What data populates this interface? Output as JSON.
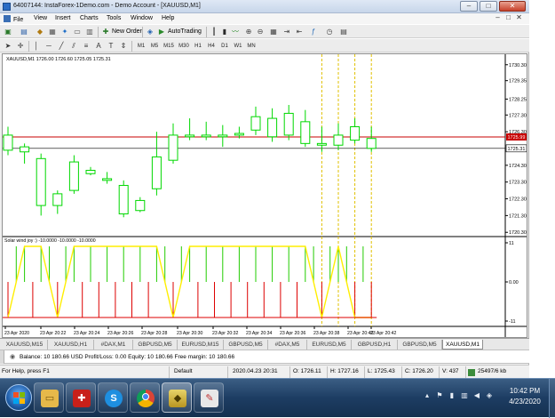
{
  "window": {
    "title": "64007144: InstaForex-1Demo.com - Demo Account - [XAUUSD,M1]",
    "controls": {
      "minimize": "–",
      "maximize": "□",
      "close": "✕"
    }
  },
  "menu": {
    "items": [
      "File",
      "View",
      "Insert",
      "Charts",
      "Tools",
      "Window",
      "Help"
    ],
    "mdi_controls": [
      "–",
      "□",
      "✕"
    ]
  },
  "toolbar": {
    "new_order": "New Order",
    "auto_trading": "AutoTrading",
    "timeframes": [
      "M1",
      "M5",
      "M15",
      "M30",
      "H1",
      "H4",
      "D1",
      "W1",
      "MN"
    ]
  },
  "chart": {
    "info": "XAUUSD,M1  1726.00 1726.60 1725.05 1725.31",
    "indicator_label": "Solar wind joy :) -10.0000 -10.0000 -10.0000",
    "current_price_label": "1725.31",
    "red_line_label": "1725.99",
    "colors": {
      "bull": "#00d800",
      "bear": "#00c000",
      "body_up_fill": "#ffffff",
      "body_down_fill": "#ffffff",
      "red_line": "#c80000",
      "current_line": "#000000",
      "vline": "#e0c000",
      "yellow": "#ffee00",
      "indicator_red": "#dd0000",
      "indicator_green": "#22cc00"
    }
  },
  "chart_data": {
    "type": "candlestick",
    "symbol": "XAUUSD",
    "timeframe": "M1",
    "y_ticks": [
      "1730.30",
      "1729.35",
      "1728.25",
      "1727.30",
      "1726.30",
      "1725.31",
      "1724.30",
      "1723.30",
      "1722.30",
      "1721.30",
      "1720.30"
    ],
    "ylim": [
      1720.1,
      1730.5
    ],
    "x_ticks": [
      "23 Apr 2020",
      "23 Apr 20:22",
      "23 Apr 20:24",
      "23 Apr 20:26",
      "23 Apr 20:28",
      "23 Apr 20:30",
      "23 Apr 20:32",
      "23 Apr 20:34",
      "23 Apr 20:36",
      "23 Apr 20:38",
      "23 Apr 20:40",
      "23 Apr 20:42"
    ],
    "candles": [
      {
        "o": 1725.2,
        "h": 1726.6,
        "l": 1724.9,
        "c": 1726.1
      },
      {
        "o": 1725.4,
        "h": 1725.6,
        "l": 1724.4,
        "c": 1725.1
      },
      {
        "o": 1724.7,
        "h": 1725.0,
        "l": 1721.3,
        "c": 1721.9
      },
      {
        "o": 1721.9,
        "h": 1722.8,
        "l": 1721.4,
        "c": 1722.6
      },
      {
        "o": 1722.8,
        "h": 1724.9,
        "l": 1722.6,
        "c": 1724.5
      },
      {
        "o": 1724.0,
        "h": 1724.2,
        "l": 1723.7,
        "c": 1723.8
      },
      {
        "o": 1723.5,
        "h": 1723.9,
        "l": 1723.2,
        "c": 1723.4
      },
      {
        "o": 1723.1,
        "h": 1723.4,
        "l": 1721.2,
        "c": 1721.4
      },
      {
        "o": 1721.6,
        "h": 1722.4,
        "l": 1721.5,
        "c": 1722.2
      },
      {
        "o": 1722.9,
        "h": 1726.3,
        "l": 1722.5,
        "c": 1724.8
      },
      {
        "o": 1724.6,
        "h": 1726.8,
        "l": 1724.4,
        "c": 1726.1
      },
      {
        "o": 1726.0,
        "h": 1727.1,
        "l": 1725.8,
        "c": 1726.1
      },
      {
        "o": 1726.1,
        "h": 1726.9,
        "l": 1725.8,
        "c": 1726.0
      },
      {
        "o": 1726.0,
        "h": 1726.7,
        "l": 1725.4,
        "c": 1726.1
      },
      {
        "o": 1726.1,
        "h": 1726.6,
        "l": 1725.9,
        "c": 1726.2
      },
      {
        "o": 1726.4,
        "h": 1727.8,
        "l": 1726.1,
        "c": 1727.2
      },
      {
        "o": 1727.1,
        "h": 1727.7,
        "l": 1725.7,
        "c": 1726.0
      },
      {
        "o": 1726.1,
        "h": 1727.9,
        "l": 1725.8,
        "c": 1727.4
      },
      {
        "o": 1726.9,
        "h": 1727.6,
        "l": 1725.4,
        "c": 1725.6
      },
      {
        "o": 1725.6,
        "h": 1726.6,
        "l": 1725.1,
        "c": 1725.5
      },
      {
        "o": 1725.5,
        "h": 1726.8,
        "l": 1725.2,
        "c": 1726.1
      },
      {
        "o": 1726.6,
        "h": 1727.1,
        "l": 1725.6,
        "c": 1725.8
      },
      {
        "o": 1725.9,
        "h": 1726.6,
        "l": 1725.1,
        "c": 1725.31
      }
    ],
    "red_line": 1725.99,
    "current_price": 1725.31,
    "indicator": {
      "y_ticks": [
        "11",
        "0.00",
        "-11"
      ],
      "ylim": [
        -11,
        11
      ],
      "yellow": [
        -10,
        10,
        10,
        -10,
        10,
        10,
        10,
        10,
        10,
        10,
        -10,
        10,
        10,
        10,
        10,
        10,
        10,
        10,
        10,
        -10,
        10,
        -10,
        -10
      ],
      "red_bars": [
        -10,
        0,
        0,
        -10,
        0,
        0,
        0,
        0,
        0,
        0,
        -10,
        0,
        0,
        0,
        0,
        0,
        0,
        0,
        0,
        -10,
        0,
        -10,
        -10
      ],
      "green_bars": [
        0,
        10,
        10,
        0,
        10,
        10,
        10,
        10,
        10,
        10,
        0,
        10,
        10,
        10,
        10,
        10,
        10,
        10,
        10,
        0,
        10,
        0,
        0
      ]
    }
  },
  "tabs": [
    {
      "label": "XAUUSD,M15",
      "active": false
    },
    {
      "label": "XAUUSD,H1",
      "active": false
    },
    {
      "label": "#DAX,M1",
      "active": false
    },
    {
      "label": "GBPUSD,M5",
      "active": false
    },
    {
      "label": "EURUSD,M15",
      "active": false
    },
    {
      "label": "GBPUSD,M5",
      "active": false
    },
    {
      "label": "#DAX,M5",
      "active": false
    },
    {
      "label": "EURUSD,M5",
      "active": false
    },
    {
      "label": "GBPUSD,H1",
      "active": false
    },
    {
      "label": "GBPUSD,M5",
      "active": false
    },
    {
      "label": "XAUUSD,M1",
      "active": true
    }
  ],
  "terminal": {
    "balance_line": "Balance: 10 180.66 USD  Profit/Loss: 0.00  Equity: 10 180.66  Free margin: 10 180.66"
  },
  "statusbar": {
    "help": "For Help, press F1",
    "profile": "Default",
    "datetime": "2020.04.23 20:31",
    "open": "O: 1726.11",
    "high": "H: 1727.16",
    "low": "L: 1725.43",
    "close": "C: 1726.20",
    "volume": "V: 437",
    "traffic": "25497/6 kb"
  },
  "taskbar": {
    "time": "10:42 PM",
    "date": "4/23/2020",
    "apps": [
      "explorer",
      "antivirus",
      "skype",
      "chrome",
      "metatrader-gold",
      "paint"
    ]
  }
}
